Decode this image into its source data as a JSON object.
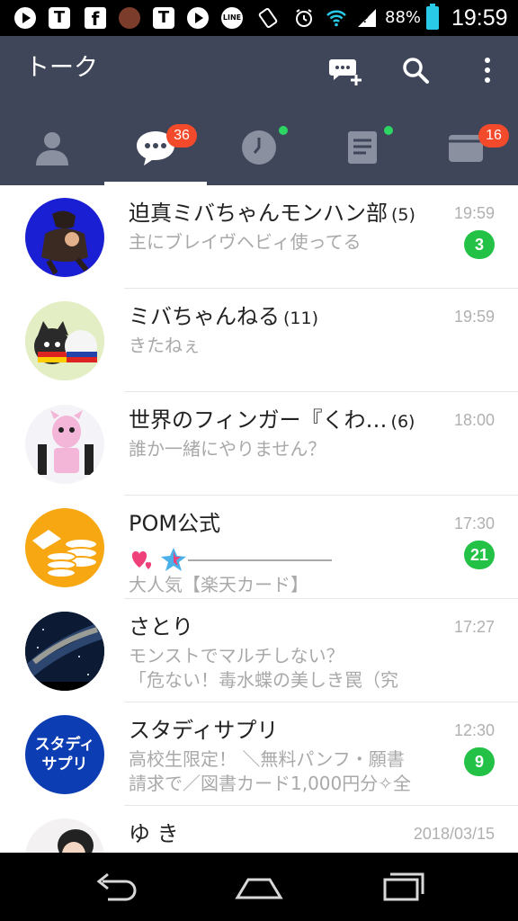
{
  "status_bar": {
    "icons": [
      "play-icon",
      "t-app-icon",
      "facebook-icon",
      "avatar-icon",
      "t-app-icon",
      "play-icon",
      "line-icon",
      "rotate-icon",
      "alarm-icon",
      "wifi-icon",
      "no-sim-icon"
    ],
    "t_letter": "T",
    "f_letter": "f",
    "line_text": "LINE",
    "battery_percent": "88%",
    "time": "19:59"
  },
  "header": {
    "title": "トーク",
    "actions": [
      "new-chat-icon",
      "search-icon",
      "more-icon"
    ]
  },
  "tabs": [
    {
      "name": "friends",
      "icon": "person-icon",
      "badge": ""
    },
    {
      "name": "talk",
      "icon": "chat-bubble-icon",
      "badge": "36",
      "active": true
    },
    {
      "name": "timeline",
      "icon": "clock-icon",
      "badge": "",
      "dot": true
    },
    {
      "name": "news",
      "icon": "news-icon",
      "badge": "",
      "dot": true
    },
    {
      "name": "wallet",
      "icon": "wallet-icon",
      "badge": "16"
    }
  ],
  "chats": [
    {
      "name": "迫真ミバちゃんモンハン部",
      "count": "(5)",
      "time": "19:59",
      "preview": "主にブレイヴヘビィ使ってる",
      "preview2": "",
      "unread": "3"
    },
    {
      "name": "ミバちゃんねる",
      "count": "(11)",
      "time": "19:59",
      "preview": "きたねぇ",
      "preview2": "",
      "unread": ""
    },
    {
      "name": "世界のフィンガー『くわ…",
      "count": "(6)",
      "time": "18:00",
      "preview": "誰か一緒にやりません？",
      "preview2": "",
      "unread": ""
    },
    {
      "name": "POM公式",
      "count": "",
      "time": "17:30",
      "preview": "",
      "preview2": "大人気【楽天カード】",
      "unread": "21"
    },
    {
      "name": "さとり",
      "count": "",
      "time": "17:27",
      "preview": "モンストでマルチしない？",
      "preview2": "「危ない！毒水蝶の美しき罠（究",
      "unread": ""
    },
    {
      "name": "スタディサプリ",
      "count": "",
      "time": "12:30",
      "preview": "高校生限定！ ＼無料パンフ・願書",
      "preview2": "請求で／図書カード1,000円分✧全",
      "unread": "9"
    },
    {
      "name": "ゆ き",
      "count": "",
      "time": "2018/03/15",
      "preview": "",
      "preview2": "",
      "unread": ""
    }
  ],
  "studysapuri_logo": {
    "line1": "スタディ",
    "line2": "サプリ"
  },
  "nav": [
    "back-icon",
    "home-icon",
    "recents-icon"
  ],
  "colors": {
    "header": "#3f4659",
    "badge_red": "#f24a2b",
    "unread_green": "#23c246",
    "accent_dot": "#2dd663"
  }
}
